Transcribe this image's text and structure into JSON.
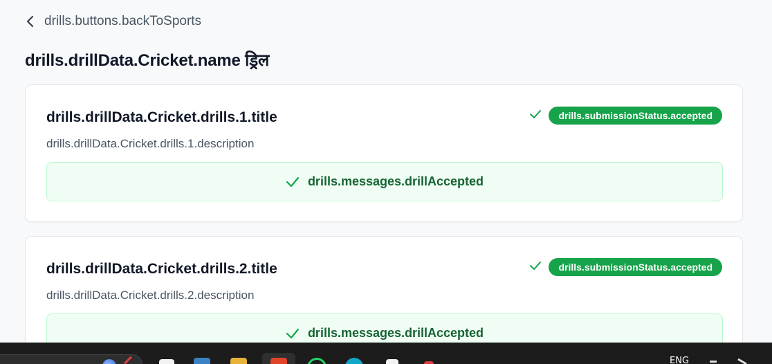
{
  "header": {
    "back_label": "drills.buttons.backToSports",
    "page_title": "drills.drillData.Cricket.name ड्रिल"
  },
  "drills": [
    {
      "title": "drills.drillData.Cricket.drills.1.title",
      "description": "drills.drillData.Cricket.drills.1.description",
      "status": "drills.submissionStatus.accepted",
      "message": "drills.messages.drillAccepted"
    },
    {
      "title": "drills.drillData.Cricket.drills.2.title",
      "description": "drills.drillData.Cricket.drills.2.description",
      "status": "drills.submissionStatus.accepted",
      "message": "drills.messages.drillAccepted"
    }
  ],
  "taskbar": {
    "language": "ENG"
  },
  "colors": {
    "accent_green": "#16a34a",
    "message_bg": "#f0fdf4",
    "message_border": "#bbf7d0",
    "message_text": "#166534"
  },
  "icons": {
    "back": "chevron-left-icon",
    "status": "check-icon",
    "message": "check-icon"
  }
}
